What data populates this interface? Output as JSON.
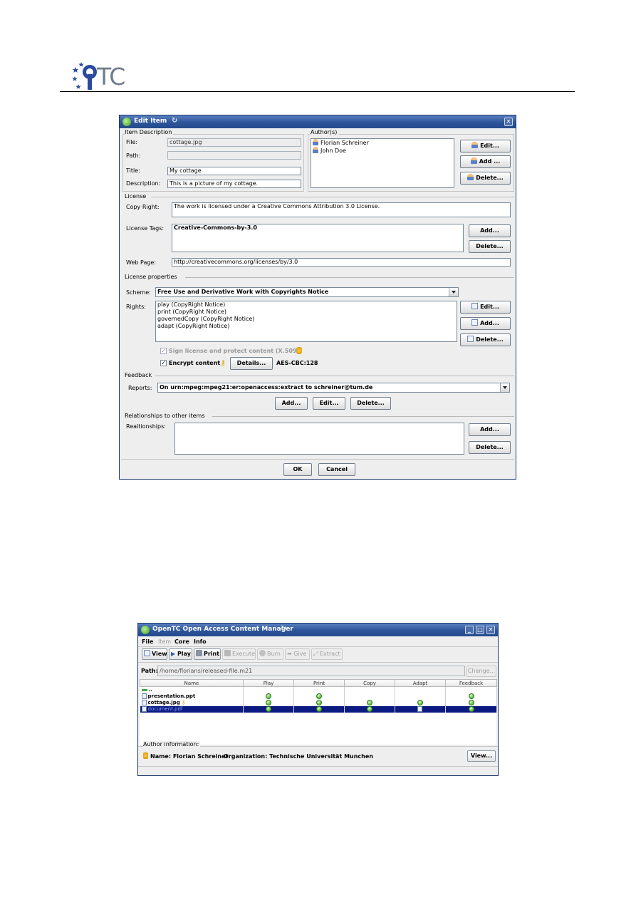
{
  "header": {
    "logo_text": "TC"
  },
  "edit_dialog": {
    "title": "Edit Item",
    "item_description": {
      "heading": "Item Description",
      "file_label": "File:",
      "file_value": "cottage.jpg",
      "path_label": "Path:",
      "path_value": "",
      "title_label": "Title:",
      "title_value": "My cottage",
      "description_label": "Description:",
      "description_value": "This is a picture of my cottage."
    },
    "authors": {
      "heading": "Author(s)",
      "items": [
        "Florian Schreiner",
        "John Doe"
      ],
      "edit_label": "Edit...",
      "add_label": "Add ...",
      "delete_label": "Delete..."
    },
    "license": {
      "heading": "License",
      "copyright_label": "Copy Right:",
      "copyright_value": "The work is licensed under a Creative Commons Attribution 3.0 License.",
      "tags_label": "License Tags:",
      "tags": [
        "Creative-Commons-by-3.0"
      ],
      "add_label": "Add...",
      "delete_label": "Delete...",
      "webpage_label": "Web Page:",
      "webpage_value": "http://creativecommons.org/licenses/by/3.0"
    },
    "license_properties": {
      "heading": "License properties",
      "scheme_label": "Scheme:",
      "scheme_value": "Free Use and Derivative Work with Copyrights Notice",
      "rights_label": "Rights:",
      "rights": [
        "play (CopyRight Notice)",
        "print (CopyRight Notice)",
        "governedCopy (CopyRight Notice)",
        "adapt (CopyRight Notice)"
      ],
      "edit_label": "Edit...",
      "add_label": "Add...",
      "delete_label": "Delete...",
      "sign_label": "Sign license and protect content (X.509)",
      "sign_checked": true,
      "encrypt_label": "Encrypt content",
      "encrypt_checked": true,
      "details_label": "Details...",
      "cipher": "AES-CBC:128"
    },
    "feedback": {
      "heading": "Feedback",
      "reports_label": "Reports:",
      "reports_value": "On urn:mpeg:mpeg21:er:openaccess:extract to schreiner@tum.de",
      "add_label": "Add...",
      "edit_label": "Edit...",
      "delete_label": "Delete..."
    },
    "relationships": {
      "heading": "Relationships to other items",
      "label": "Realtionships:",
      "add_label": "Add...",
      "delete_label": "Delete..."
    },
    "ok_label": "OK",
    "cancel_label": "Cancel"
  },
  "manager": {
    "title": "OpenTC Open Access Content Manager",
    "menu": [
      "File",
      "Item",
      "Core",
      "Info"
    ],
    "toolbar": {
      "view": "View",
      "play": "Play",
      "print": "Print",
      "execute": "Execute",
      "burn": "Burn",
      "give": "Give",
      "extract": "Extract"
    },
    "path_label": "Path:",
    "path_value": "/home/florians/released-file.m21",
    "change_label": "Change...",
    "columns": [
      "Name",
      "Play",
      "Print",
      "Copy",
      "Adapt",
      "Feedback"
    ],
    "rows": [
      {
        "name": "..",
        "play": false,
        "print": false,
        "copy": false,
        "adapt": false,
        "feedback": false
      },
      {
        "name": "presentation.ppt",
        "play": true,
        "print": true,
        "copy": false,
        "adapt": false,
        "feedback": true
      },
      {
        "name": "cottage.jpg",
        "play": true,
        "print": true,
        "copy": true,
        "adapt": true,
        "feedback": true
      },
      {
        "name": "document.pdf",
        "play": true,
        "print": true,
        "copy": true,
        "adapt": "doc",
        "feedback": true
      }
    ],
    "author_info_heading": "Author information:",
    "author_name": "Name: Florian Schreiner",
    "author_org": "Organization: Technische Universität Munchen",
    "view_label": "View..."
  }
}
